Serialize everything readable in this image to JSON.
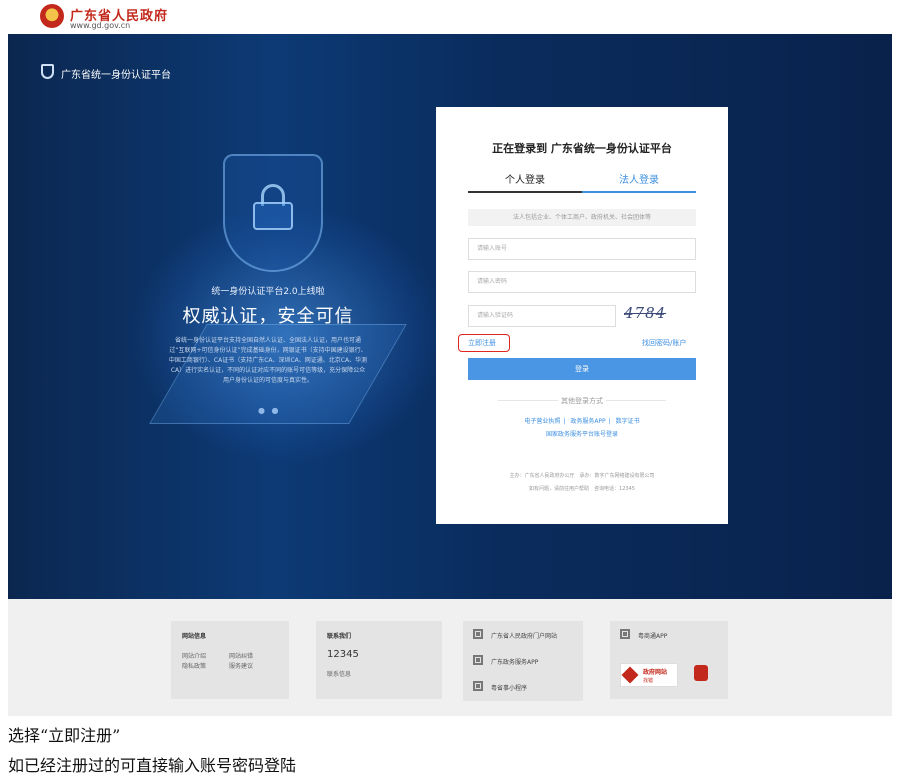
{
  "header": {
    "gov_name": "广东省人民政府",
    "gov_url": "www.gd.gov.cn"
  },
  "hero": {
    "brand": "广东省统一身份认证平台",
    "subtitle": "统一身份认证平台2.0上线啦",
    "title": "权威认证，安全可信",
    "description": "省统一身份认证平台支持全国自然人认证、全国法人认证，用户也可通过“互联网+可信身份认证”完成基础身份，网银证书（支持中国建设银行、中国工商银行）、CA证书（支持广东CA、深圳CA、网证通、北京CA、华测CA）进行实名认证，不同的认证对应不同的账号可信等级，充分保障公众用户身份认证的可信度与真实性。",
    "dots": "● ●"
  },
  "login": {
    "title": "正在登录到 广东省统一身份认证平台",
    "tab_personal": "个人登录",
    "tab_legal": "法人登录",
    "tip": "法人包括企业、个体工商户、政府机关、社会团体等",
    "account_placeholder": "请输入账号",
    "password_placeholder": "请输入密码",
    "captcha_placeholder": "请输入验证码",
    "captcha_text": "4784",
    "register": "立即注册",
    "forgot": "找回密码/账户",
    "login_button": "登录",
    "other_methods": "其他登录方式",
    "other_links": [
      "电子营业执照",
      "政务服务APP",
      "数字证书"
    ],
    "national_link": "国家政务服务平台账号登录",
    "footer_line1": "主办：广东省人民政府办公厅　承办：数字广东网络建设有限公司",
    "footer_line2": "如有问题，请前往用户帮助　咨询电话：12345"
  },
  "footer": {
    "site_info": {
      "title": "网站信息",
      "links": [
        "网站介绍",
        "网站纠错",
        "隐私政策",
        "服务建议"
      ]
    },
    "contact": {
      "title": "联系我们",
      "phone": "12345",
      "info": "联系信息"
    },
    "qr_links": [
      "广东省人民政府门户网站",
      "广东政务服务APP",
      "粤省事小程序"
    ],
    "yuetong": "粤商通APP",
    "gov_badge": "政府网站",
    "gov_badge_sub": "找错"
  },
  "instructions": {
    "step1": "选择“立即注册”",
    "step2": "如已经注册过的可直接输入账号密码登陆"
  },
  "colors": {
    "accent": "#4a95e4",
    "highlight": "#e0261e",
    "brand_red": "#c3281c"
  }
}
